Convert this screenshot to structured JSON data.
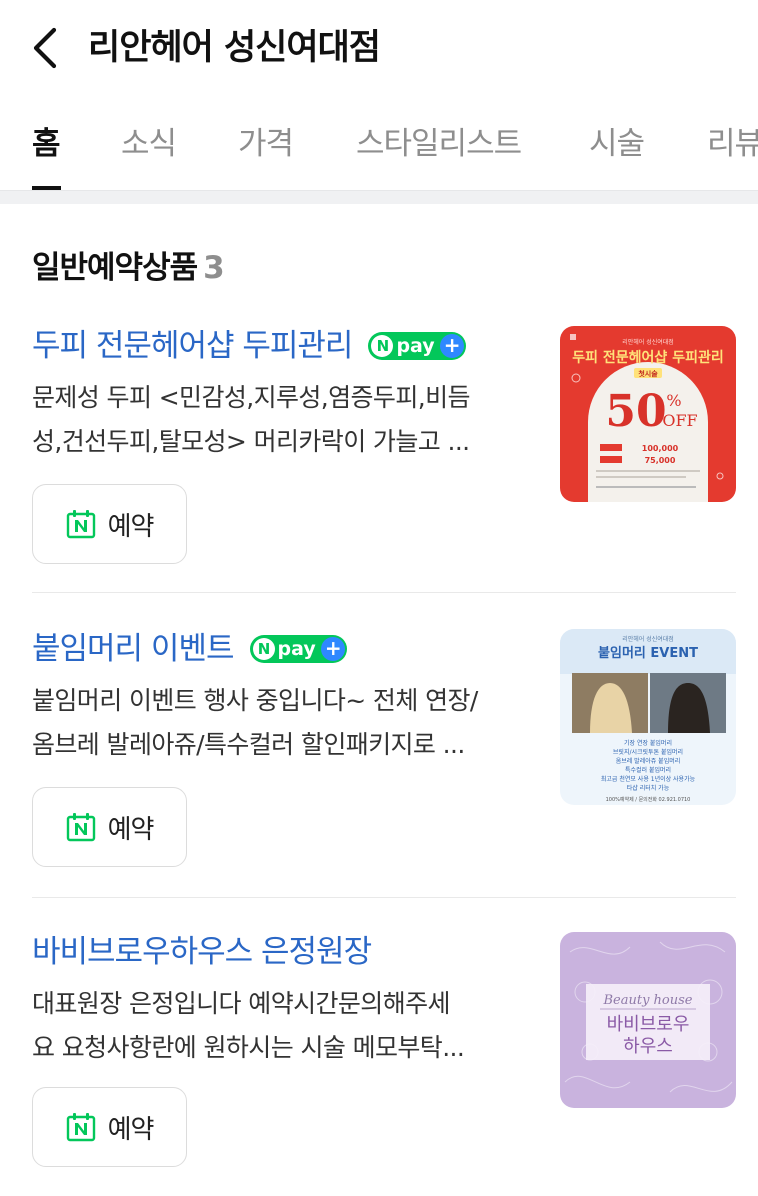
{
  "header": {
    "title": "리안헤어 성신여대점"
  },
  "tabs": [
    {
      "label": "홈",
      "active": true
    },
    {
      "label": "소식",
      "active": false
    },
    {
      "label": "가격",
      "active": false
    },
    {
      "label": "스타일리스트",
      "active": false
    },
    {
      "label": "시술",
      "active": false
    },
    {
      "label": "리뷰",
      "active": false
    }
  ],
  "section": {
    "title": "일반예약상품",
    "count": "3"
  },
  "products": [
    {
      "name": "두피 전문헤어샵 두피관리",
      "npay": true,
      "desc_line1": "문제성 두피 <민감성,지루성,염증두피,비듬",
      "desc_line2": "성,건선두피,탈모성> 머리카락이 가늘고 ...",
      "reserve_label": "예약",
      "thumb": {
        "shop_small": "리안헤어 성신여대점",
        "headline": "두피 전문헤어샵 두피관리",
        "sub": "첫시술",
        "discount": "50",
        "pct": "%",
        "off": "OFF",
        "price1": "100,000",
        "price2": "75,000"
      }
    },
    {
      "name": "붙임머리 이벤트",
      "npay": true,
      "desc_line1": "붙임머리 이벤트 행사 중입니다~ 전체 연장/",
      "desc_line2": "옴브레 발레아쥬/특수컬러 할인패키지로 ...",
      "reserve_label": "예약",
      "thumb": {
        "shop_small": "리안헤어 성신여대점",
        "headline": "붙임머리 EVENT",
        "lines": [
          "기장 연장 붙임머리",
          "브릿지/시크릿투톤 붙임머리",
          "옴브레 발레아쥬 붙임머리",
          "특수컬러 붙임머리",
          "최고급 천연모 사용 1년이상 사용가능",
          "타샵 리터치 가능"
        ],
        "footer": "100%예약제 / 문의전화 02.921.0710"
      }
    },
    {
      "name": "바비브로우하우스 은정원장",
      "npay": false,
      "desc_line1": "대표원장 은정입니다 예약시간문의해주세",
      "desc_line2": "요 요청사항란에 원하시는 시술 메모부탁...",
      "reserve_label": "예약",
      "thumb": {
        "script": "Beauty house",
        "line1": "바비브로우",
        "line2": "하우스"
      }
    }
  ],
  "colors": {
    "link_blue": "#2a67c6",
    "npay_green": "#03c75a",
    "npay_plus_blue": "#2e88ff",
    "muted_gray": "#8e8e8e",
    "naver_green": "#03c75a"
  },
  "icons": {
    "back": "chevron-left-icon",
    "reserve": "naver-calendar-icon"
  }
}
